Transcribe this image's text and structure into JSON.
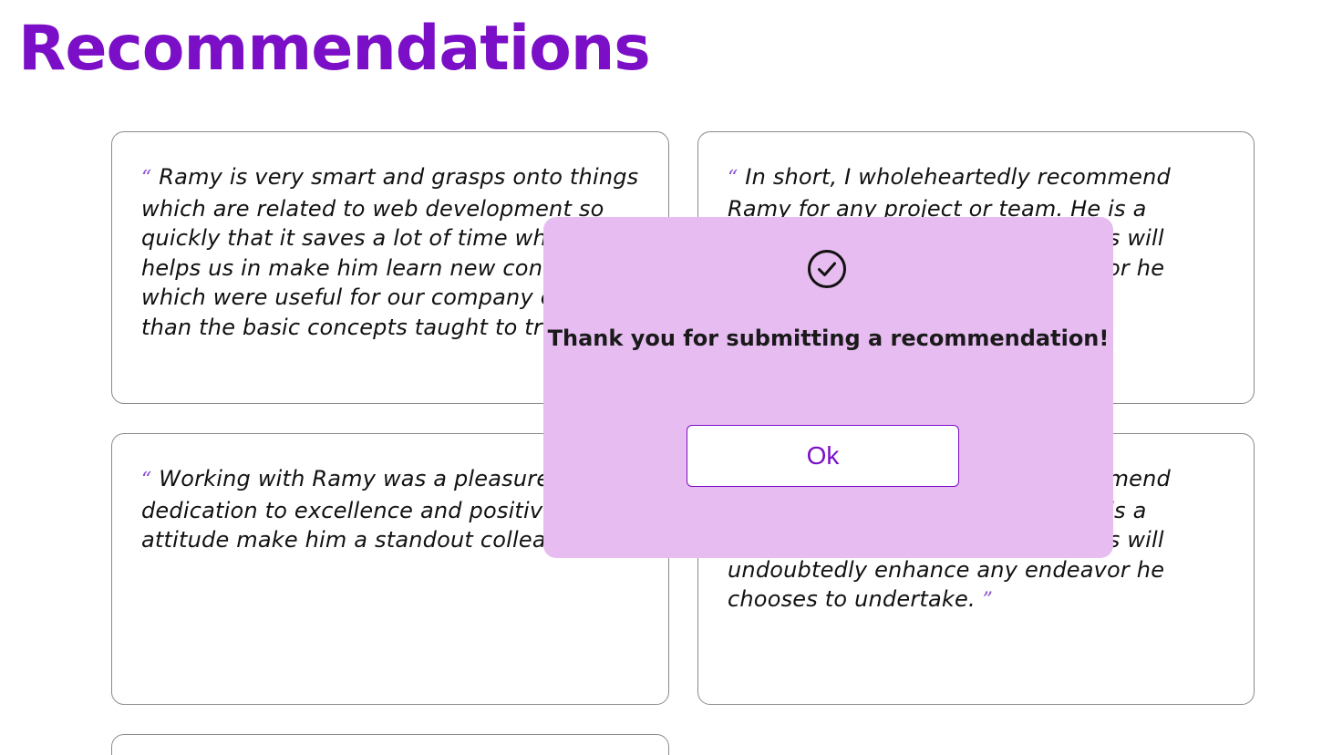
{
  "page": {
    "title": "Recommendations"
  },
  "quote_marks": {
    "open": "“",
    "close": "”"
  },
  "recommendations": [
    {
      "text": "Ramy is very smart and grasps onto things which are related to web development so quickly that it saves a lot of time which helps us in make him learn new concepts which were useful for our company other than the basic concepts taught to trainees."
    },
    {
      "text": "In short, I wholeheartedly recommend Ramy for any project or team. He is a valuable asset whose contributions will undoubtedly enhance any endeavor he chooses to undertake."
    },
    {
      "text": "Working with Ramy was a pleasure. His dedication to excellence and positive attitude make him a standout colleague."
    },
    {
      "text": "In short, I wholeheartedly recommend Ramy for any project or team. He is a valuable asset whose contributions will undoubtedly enhance any endeavor he chooses to undertake."
    }
  ],
  "modal": {
    "icon": "check-circle-icon",
    "message": "Thank you for submitting a recommendation!",
    "ok_label": "Ok"
  },
  "colors": {
    "accent": "#7b0fc7",
    "modal_background": "#e6bcf1",
    "quote_mark": "#8a4fd0"
  }
}
